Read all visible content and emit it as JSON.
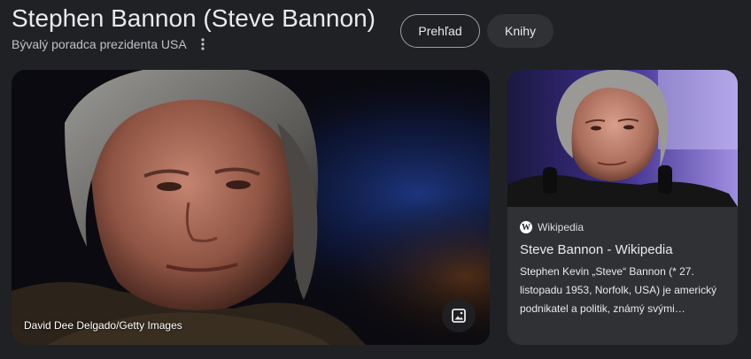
{
  "header": {
    "title": "Stephen Bannon (Steve Bannon)",
    "subtitle": "Bývalý poradca prezidenta USA",
    "more_icon": "more-vertical-icon"
  },
  "tabs": [
    {
      "label": "Prehľad",
      "selected": true
    },
    {
      "label": "Knihy",
      "selected": false
    }
  ],
  "main_image": {
    "credit": "David Dee Delgado/Getty Images",
    "action_icon": "image-icon"
  },
  "wiki_card": {
    "source": "Wikipedia",
    "logo_letter": "W",
    "title": "Steve Bannon - Wikipedia",
    "snippet": "Stephen Kevin „Steve“ Bannon (* 27. listopadu 1953, Norfolk, USA) je americký podnikatel a politik, známý svými…"
  },
  "colors": {
    "background": "#202124",
    "card": "#303134",
    "text": "#e8eaed",
    "muted_text": "#bdc1c6"
  }
}
